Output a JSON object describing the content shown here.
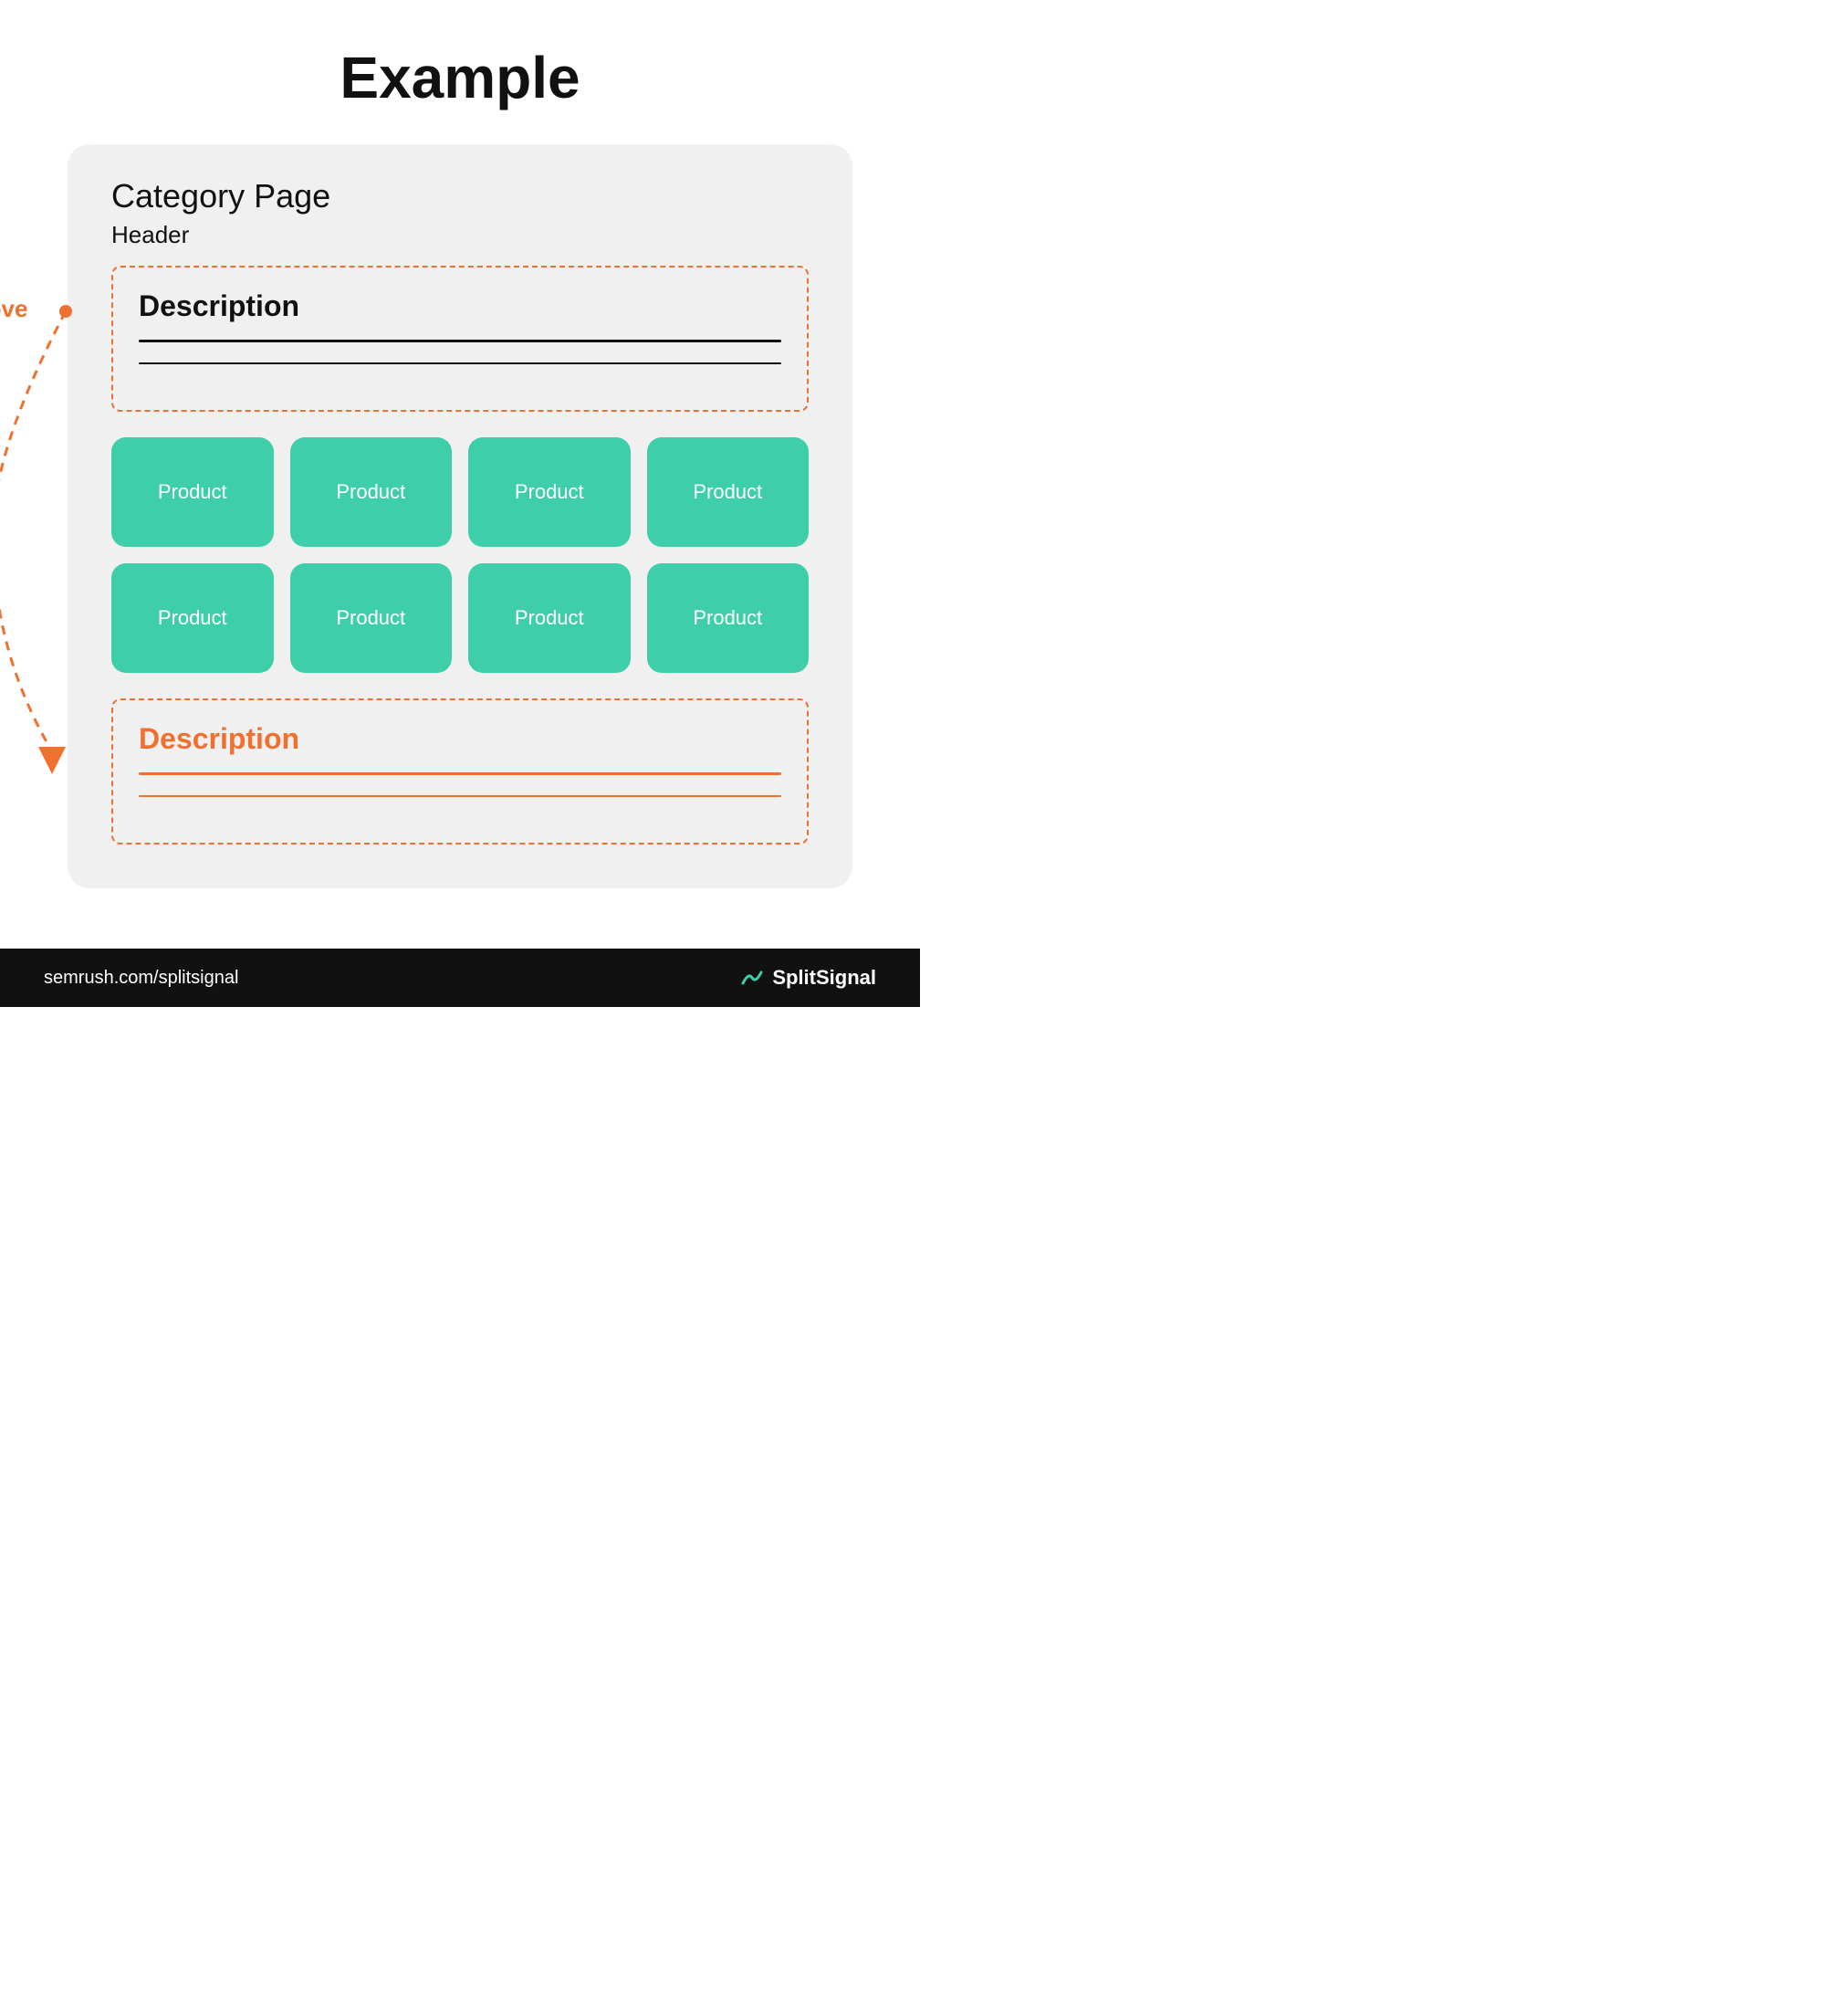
{
  "page": {
    "title": "Example"
  },
  "category_page": {
    "title": "Category Page",
    "header_label": "Header"
  },
  "move_label": "Move",
  "description_top": {
    "title": "Description",
    "lines": 2
  },
  "description_bottom": {
    "title": "Description",
    "lines": 2
  },
  "product_grid": {
    "items": [
      {
        "label": "Product"
      },
      {
        "label": "Product"
      },
      {
        "label": "Product"
      },
      {
        "label": "Product"
      },
      {
        "label": "Product"
      },
      {
        "label": "Product"
      },
      {
        "label": "Product"
      },
      {
        "label": "Product"
      }
    ]
  },
  "footer": {
    "url": "semrush.com/splitsignal",
    "brand": "SplitSignal"
  }
}
